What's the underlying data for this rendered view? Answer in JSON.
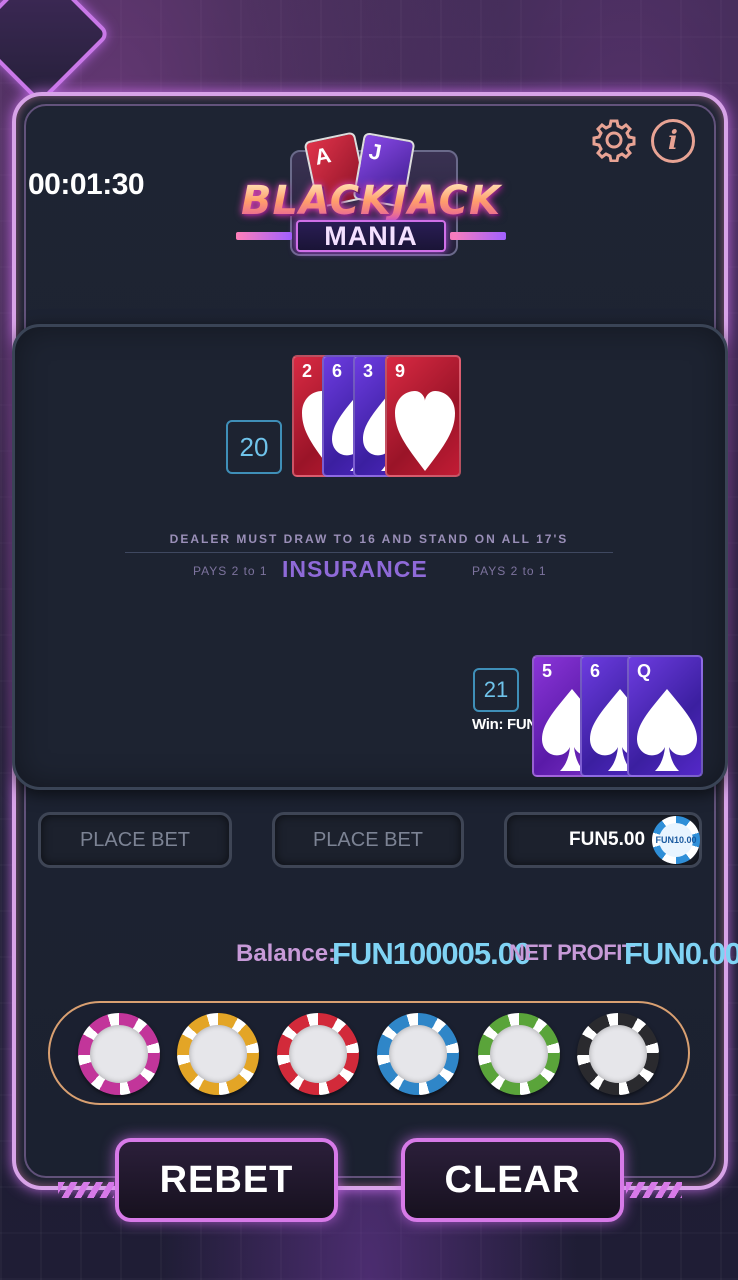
{
  "game": {
    "timer": "00:01:30",
    "logo": {
      "title": "BLACKJACK",
      "subtitle": "MANIA",
      "card1": "A",
      "card2": "J"
    }
  },
  "dealer": {
    "score": "20",
    "cards": [
      {
        "rank": "2",
        "suit": "heart-icon",
        "color": "#c21c35"
      },
      {
        "rank": "6",
        "suit": "spade-icon",
        "color": "#4a22b8"
      },
      {
        "rank": "3",
        "suit": "spade-icon",
        "color": "#4a22b8"
      },
      {
        "rank": "9",
        "suit": "heart-icon",
        "color": "#c21c35"
      }
    ]
  },
  "table_text": {
    "rules": "DEALER MUST DRAW TO 16 AND STAND ON ALL 17'S",
    "pays_left": "PAYS 2  to 1",
    "insurance": "INSURANCE",
    "pays_right": "PAYS 2  to 1"
  },
  "player": {
    "score": "21",
    "win_text": "Win: FUN10",
    "cards": [
      {
        "rank": "5",
        "suit": "spade-icon",
        "color": "#7a30c8"
      },
      {
        "rank": "6",
        "suit": "spade-icon",
        "color": "#5428c8"
      },
      {
        "rank": "Q",
        "suit": "spade-icon",
        "color": "#5428c8"
      }
    ]
  },
  "bets": {
    "slot1": "PLACE BET",
    "slot2": "PLACE BET",
    "slot3_amount": "FUN5.00",
    "slot3_chip": "FUN10.00"
  },
  "balance": {
    "label": "Balance:",
    "value": "FUN100005.00",
    "net_profit_label": "NET PROFIT",
    "net_profit_value": "FUN0.00"
  },
  "chips": [
    {
      "color": "#c2359a"
    },
    {
      "color": "#e3a526"
    },
    {
      "color": "#d22a3a"
    },
    {
      "color": "#2f86c8"
    },
    {
      "color": "#5aa43a"
    },
    {
      "color": "#2a2a2e"
    }
  ],
  "actions": {
    "rebet": "REBET",
    "clear": "CLEAR"
  }
}
